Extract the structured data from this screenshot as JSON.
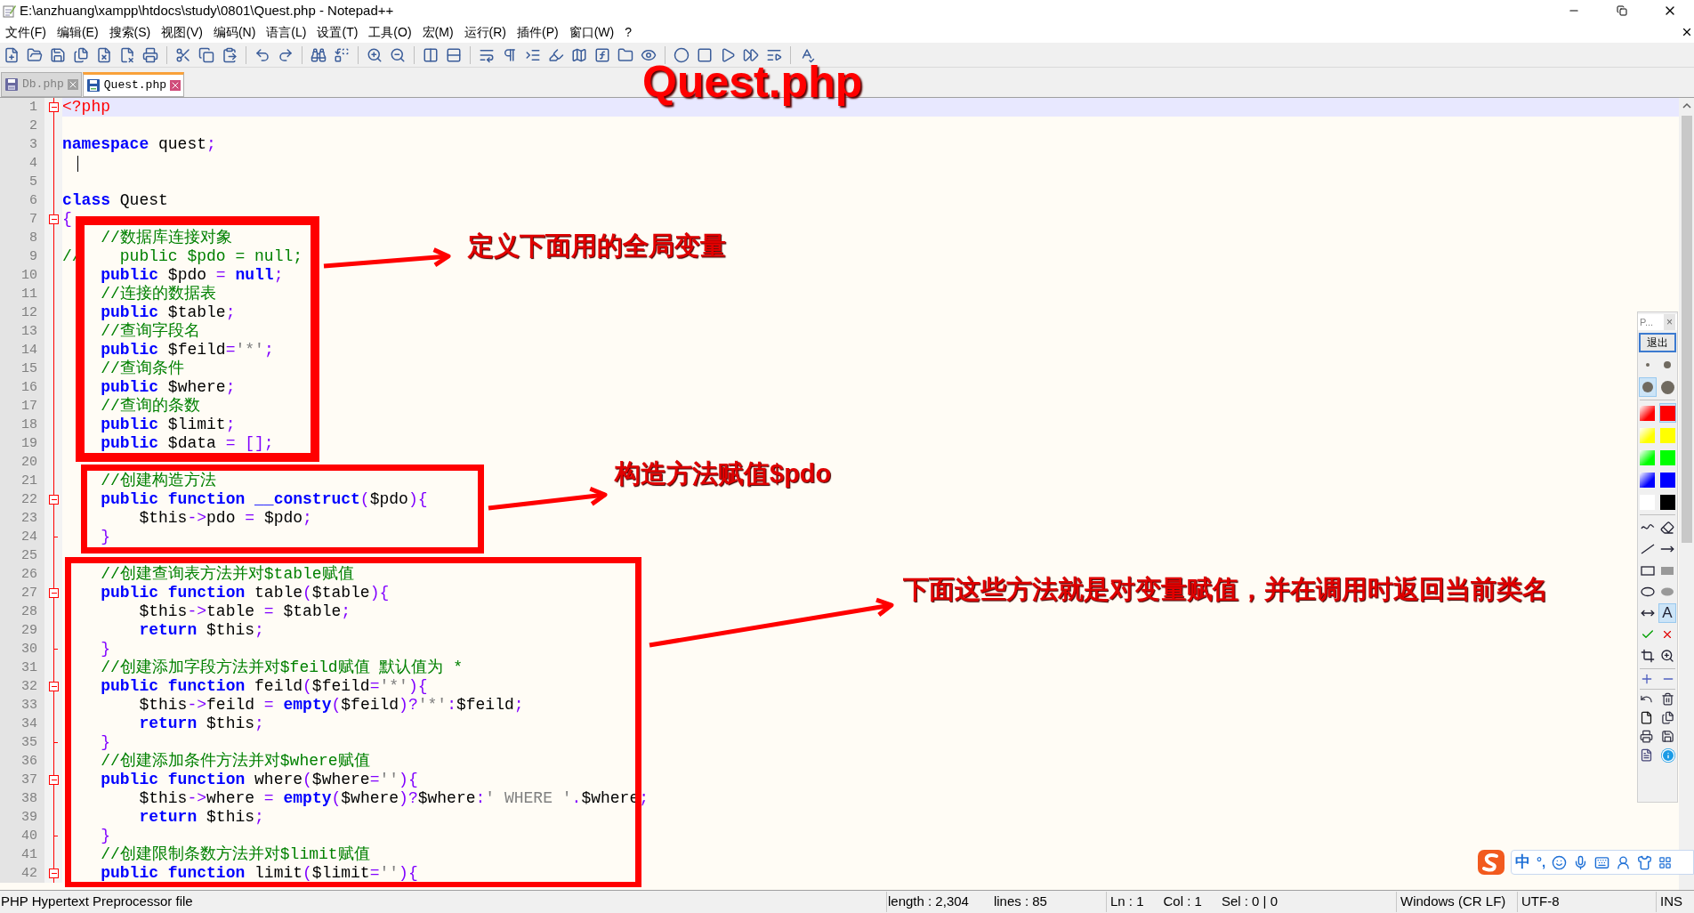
{
  "window": {
    "title": "E:\\anzhuang\\xampp\\htdocs\\study\\0801\\Quest.php - Notepad++"
  },
  "menu": [
    "文件(F)",
    "编辑(E)",
    "搜索(S)",
    "视图(V)",
    "编码(N)",
    "语言(L)",
    "设置(T)",
    "工具(O)",
    "宏(M)",
    "运行(R)",
    "插件(P)",
    "窗口(W)",
    "?"
  ],
  "tabs": [
    {
      "label": "Db.php",
      "selected": false
    },
    {
      "label": "Quest.php",
      "selected": true
    }
  ],
  "code": [
    {
      "number": "1",
      "kind": "fold-start",
      "highlighted": true,
      "tokens": [
        {
          "kind": "tag",
          "text": "<?php"
        }
      ]
    },
    {
      "number": "2",
      "kind": "text",
      "highlighted": false
    },
    {
      "number": "3",
      "kind": "text",
      "highlighted": false,
      "tokens": [
        {
          "kind": "keyword",
          "text": "namespace"
        },
        {
          "kind": "plain",
          "text": " quest"
        },
        {
          "kind": "op",
          "text": ";"
        }
      ]
    },
    {
      "number": "4",
      "kind": "text",
      "highlighted": false
    },
    {
      "number": "5",
      "kind": "text",
      "highlighted": false
    },
    {
      "number": "6",
      "kind": "text",
      "highlighted": false,
      "tokens": [
        {
          "kind": "keyword",
          "text": "class"
        },
        {
          "kind": "plain",
          "text": " Quest"
        }
      ]
    },
    {
      "number": "7",
      "kind": "fold-start",
      "highlighted": false,
      "tokens": [
        {
          "kind": "op",
          "text": "{"
        }
      ]
    },
    {
      "number": "8",
      "kind": "text",
      "highlighted": false,
      "tokens": [
        {
          "kind": "comment",
          "text": "    //数据库连接对象"
        }
      ]
    },
    {
      "number": "9",
      "kind": "text",
      "highlighted": false,
      "tokens": [
        {
          "kind": "comment",
          "text": "//    public $pdo = null;"
        }
      ]
    },
    {
      "number": "10",
      "kind": "text",
      "highlighted": false,
      "tokens": [
        {
          "kind": "keyword",
          "text": "    public"
        },
        {
          "kind": "plain",
          "text": " $pdo "
        },
        {
          "kind": "op",
          "text": "="
        },
        {
          "kind": "keyword",
          "text": " null"
        },
        {
          "kind": "op",
          "text": ";"
        }
      ]
    },
    {
      "number": "11",
      "kind": "text",
      "highlighted": false,
      "tokens": [
        {
          "kind": "comment",
          "text": "    //连接的数据表"
        }
      ]
    },
    {
      "number": "12",
      "kind": "text",
      "highlighted": false,
      "tokens": [
        {
          "kind": "keyword",
          "text": "    public"
        },
        {
          "kind": "plain",
          "text": " $table"
        },
        {
          "kind": "op",
          "text": ";"
        }
      ]
    },
    {
      "number": "13",
      "kind": "text",
      "highlighted": false,
      "tokens": [
        {
          "kind": "comment",
          "text": "    //查询字段名"
        }
      ]
    },
    {
      "number": "14",
      "kind": "text",
      "highlighted": false,
      "tokens": [
        {
          "kind": "keyword",
          "text": "    public"
        },
        {
          "kind": "plain",
          "text": " $feild"
        },
        {
          "kind": "op",
          "text": "="
        },
        {
          "kind": "string",
          "text": "'*'"
        },
        {
          "kind": "op",
          "text": ";"
        }
      ]
    },
    {
      "number": "15",
      "kind": "text",
      "highlighted": false,
      "tokens": [
        {
          "kind": "comment",
          "text": "    //查询条件"
        }
      ]
    },
    {
      "number": "16",
      "kind": "text",
      "highlighted": false,
      "tokens": [
        {
          "kind": "keyword",
          "text": "    public"
        },
        {
          "kind": "plain",
          "text": " $where"
        },
        {
          "kind": "op",
          "text": ";"
        }
      ]
    },
    {
      "number": "17",
      "kind": "text",
      "highlighted": false,
      "tokens": [
        {
          "kind": "comment",
          "text": "    //查询的条数"
        }
      ]
    },
    {
      "number": "18",
      "kind": "text",
      "highlighted": false,
      "tokens": [
        {
          "kind": "keyword",
          "text": "    public"
        },
        {
          "kind": "plain",
          "text": " $limit"
        },
        {
          "kind": "op",
          "text": ";"
        }
      ]
    },
    {
      "number": "19",
      "kind": "text",
      "highlighted": false,
      "tokens": [
        {
          "kind": "keyword",
          "text": "    public"
        },
        {
          "kind": "plain",
          "text": " $data "
        },
        {
          "kind": "op",
          "text": "= [];"
        }
      ]
    },
    {
      "number": "20",
      "kind": "text",
      "highlighted": false
    },
    {
      "number": "21",
      "kind": "text",
      "highlighted": false,
      "tokens": [
        {
          "kind": "comment",
          "text": "    //创建构造方法"
        }
      ]
    },
    {
      "number": "22",
      "kind": "fold-start",
      "highlighted": false,
      "tokens": [
        {
          "kind": "keyword",
          "text": "    public function __construct"
        },
        {
          "kind": "op",
          "text": "("
        },
        {
          "kind": "plain",
          "text": "$pdo"
        },
        {
          "kind": "op",
          "text": "){"
        }
      ]
    },
    {
      "number": "23",
      "kind": "text",
      "highlighted": false,
      "tokens": [
        {
          "kind": "plain",
          "text": "        $this"
        },
        {
          "kind": "op",
          "text": "->"
        },
        {
          "kind": "plain",
          "text": "pdo "
        },
        {
          "kind": "op",
          "text": "="
        },
        {
          "kind": "plain",
          "text": " $pdo"
        },
        {
          "kind": "op",
          "text": ";"
        }
      ]
    },
    {
      "number": "24",
      "kind": "fold-end",
      "highlighted": false,
      "tokens": [
        {
          "kind": "op",
          "text": "    }"
        }
      ]
    },
    {
      "number": "25",
      "kind": "text",
      "highlighted": false
    },
    {
      "number": "26",
      "kind": "text",
      "highlighted": false,
      "tokens": [
        {
          "kind": "comment",
          "text": "    //创建查询表方法并对$table赋值"
        }
      ]
    },
    {
      "number": "27",
      "kind": "fold-start",
      "highlighted": false,
      "tokens": [
        {
          "kind": "keyword",
          "text": "    public function"
        },
        {
          "kind": "plain",
          "text": " table"
        },
        {
          "kind": "op",
          "text": "("
        },
        {
          "kind": "plain",
          "text": "$table"
        },
        {
          "kind": "op",
          "text": "){"
        }
      ]
    },
    {
      "number": "28",
      "kind": "text",
      "highlighted": false,
      "tokens": [
        {
          "kind": "plain",
          "text": "        $this"
        },
        {
          "kind": "op",
          "text": "->"
        },
        {
          "kind": "plain",
          "text": "table "
        },
        {
          "kind": "op",
          "text": "="
        },
        {
          "kind": "plain",
          "text": " $table"
        },
        {
          "kind": "op",
          "text": ";"
        }
      ]
    },
    {
      "number": "29",
      "kind": "text",
      "highlighted": false,
      "tokens": [
        {
          "kind": "keyword",
          "text": "        return"
        },
        {
          "kind": "plain",
          "text": " $this"
        },
        {
          "kind": "op",
          "text": ";"
        }
      ]
    },
    {
      "number": "30",
      "kind": "fold-end",
      "highlighted": false,
      "tokens": [
        {
          "kind": "op",
          "text": "    }"
        }
      ]
    },
    {
      "number": "31",
      "kind": "text",
      "highlighted": false,
      "tokens": [
        {
          "kind": "comment",
          "text": "    //创建添加字段方法并对$feild赋值 默认值为 *"
        }
      ]
    },
    {
      "number": "32",
      "kind": "fold-start",
      "highlighted": false,
      "tokens": [
        {
          "kind": "keyword",
          "text": "    public function"
        },
        {
          "kind": "plain",
          "text": " feild"
        },
        {
          "kind": "op",
          "text": "("
        },
        {
          "kind": "plain",
          "text": "$feild"
        },
        {
          "kind": "op",
          "text": "="
        },
        {
          "kind": "string",
          "text": "'*'"
        },
        {
          "kind": "op",
          "text": "){"
        }
      ]
    },
    {
      "number": "33",
      "kind": "text",
      "highlighted": false,
      "tokens": [
        {
          "kind": "plain",
          "text": "        $this"
        },
        {
          "kind": "op",
          "text": "->"
        },
        {
          "kind": "plain",
          "text": "feild "
        },
        {
          "kind": "op",
          "text": "="
        },
        {
          "kind": "keyword",
          "text": " empty"
        },
        {
          "kind": "op",
          "text": "("
        },
        {
          "kind": "plain",
          "text": "$feild"
        },
        {
          "kind": "op",
          "text": ")?"
        },
        {
          "kind": "string",
          "text": "'*'"
        },
        {
          "kind": "op",
          "text": ":"
        },
        {
          "kind": "plain",
          "text": "$feild"
        },
        {
          "kind": "op",
          "text": ";"
        }
      ]
    },
    {
      "number": "34",
      "kind": "text",
      "highlighted": false,
      "tokens": [
        {
          "kind": "keyword",
          "text": "        return"
        },
        {
          "kind": "plain",
          "text": " $this"
        },
        {
          "kind": "op",
          "text": ";"
        }
      ]
    },
    {
      "number": "35",
      "kind": "fold-end",
      "highlighted": false,
      "tokens": [
        {
          "kind": "op",
          "text": "    }"
        }
      ]
    },
    {
      "number": "36",
      "kind": "text",
      "highlighted": false,
      "tokens": [
        {
          "kind": "comment",
          "text": "    //创建添加条件方法并对$where赋值"
        }
      ]
    },
    {
      "number": "37",
      "kind": "fold-start",
      "highlighted": false,
      "tokens": [
        {
          "kind": "keyword",
          "text": "    public function"
        },
        {
          "kind": "plain",
          "text": " where"
        },
        {
          "kind": "op",
          "text": "("
        },
        {
          "kind": "plain",
          "text": "$where"
        },
        {
          "kind": "op",
          "text": "="
        },
        {
          "kind": "string",
          "text": "''"
        },
        {
          "kind": "op",
          "text": "){"
        }
      ]
    },
    {
      "number": "38",
      "kind": "text",
      "highlighted": false,
      "tokens": [
        {
          "kind": "plain",
          "text": "        $this"
        },
        {
          "kind": "op",
          "text": "->"
        },
        {
          "kind": "plain",
          "text": "where "
        },
        {
          "kind": "op",
          "text": "="
        },
        {
          "kind": "keyword",
          "text": " empty"
        },
        {
          "kind": "op",
          "text": "("
        },
        {
          "kind": "plain",
          "text": "$where"
        },
        {
          "kind": "op",
          "text": ")?"
        },
        {
          "kind": "plain",
          "text": "$where"
        },
        {
          "kind": "op",
          "text": ":"
        },
        {
          "kind": "string",
          "text": "' WHERE '"
        },
        {
          "kind": "op",
          "text": "."
        },
        {
          "kind": "plain",
          "text": "$where"
        },
        {
          "kind": "op",
          "text": ";"
        }
      ]
    },
    {
      "number": "39",
      "kind": "text",
      "highlighted": false,
      "tokens": [
        {
          "kind": "keyword",
          "text": "        return"
        },
        {
          "kind": "plain",
          "text": " $this"
        },
        {
          "kind": "op",
          "text": ";"
        }
      ]
    },
    {
      "number": "40",
      "kind": "fold-end",
      "highlighted": false,
      "tokens": [
        {
          "kind": "op",
          "text": "    }"
        }
      ]
    },
    {
      "number": "41",
      "kind": "text",
      "highlighted": false,
      "tokens": [
        {
          "kind": "comment",
          "text": "    //创建限制条数方法并对$limit赋值"
        }
      ]
    },
    {
      "number": "42",
      "kind": "fold-start",
      "highlighted": false,
      "tokens": [
        {
          "kind": "keyword",
          "text": "    public function"
        },
        {
          "kind": "plain",
          "text": " limit"
        },
        {
          "kind": "op",
          "text": "("
        },
        {
          "kind": "plain",
          "text": "$limit"
        },
        {
          "kind": "op",
          "text": "="
        },
        {
          "kind": "string",
          "text": "''"
        },
        {
          "kind": "op",
          "text": "){"
        }
      ]
    }
  ],
  "annotations": {
    "title": "Quest.php",
    "notes": [
      {
        "text": "定义下面用的全局变量"
      },
      {
        "text": "构造方法赋值$pdo"
      },
      {
        "text": "下面这些方法就是对变量赋值，并在调用时返回当前类名"
      }
    ]
  },
  "pen_panel": {
    "title": "P...",
    "close": "×",
    "exit_button": "退出",
    "sizes": [
      {
        "selected": false
      },
      {
        "selected": false
      },
      {
        "selected": true
      },
      {
        "selected": false
      }
    ],
    "colors": [
      {
        "kind": "gradient",
        "color": "#ff0000",
        "selected": false
      },
      {
        "kind": "solid",
        "color": "#ff0000",
        "selected": true
      },
      {
        "kind": "gradient",
        "color": "#ffff00",
        "selected": false
      },
      {
        "kind": "solid",
        "color": "#ffff00",
        "selected": false
      },
      {
        "kind": "gradient",
        "color": "#00ff00",
        "selected": false
      },
      {
        "kind": "solid",
        "color": "#00ff00",
        "selected": false
      },
      {
        "kind": "gradient",
        "color": "#0000ff",
        "selected": false
      },
      {
        "kind": "solid",
        "color": "#0000ff",
        "selected": false
      },
      {
        "kind": "solid",
        "color": "#ffffff",
        "selected": false
      },
      {
        "kind": "solid",
        "color": "#000000",
        "selected": false
      }
    ],
    "tools": [
      {
        "kind": "curve",
        "selected": false
      },
      {
        "kind": "eraser",
        "selected": false
      },
      {
        "kind": "line",
        "selected": false
      },
      {
        "kind": "arrow",
        "selected": false
      },
      {
        "kind": "rectangle",
        "selected": false
      },
      {
        "kind": "filled-rectangle",
        "selected": false
      },
      {
        "kind": "ellipse",
        "selected": false
      },
      {
        "kind": "filled-ellipse",
        "selected": false
      },
      {
        "kind": "double-arrow",
        "selected": false
      },
      {
        "kind": "text",
        "label": "A",
        "selected": true
      },
      {
        "kind": "check",
        "selected": false
      },
      {
        "kind": "cross",
        "selected": false
      },
      {
        "kind": "crop",
        "selected": false
      },
      {
        "kind": "zoom",
        "selected": false
      }
    ]
  },
  "ime_bar": {
    "mode": "中",
    "punctuation": "°,"
  },
  "status_bar": {
    "file_type": "PHP Hypertext Preprocessor file",
    "length": "length : 2,304",
    "lines": "lines : 85",
    "ln": "Ln : 1",
    "col": "Col : 1",
    "sel": "Sel : 0 | 0",
    "eol": "Windows (CR LF)",
    "encoding": "UTF-8",
    "mode": "INS"
  }
}
